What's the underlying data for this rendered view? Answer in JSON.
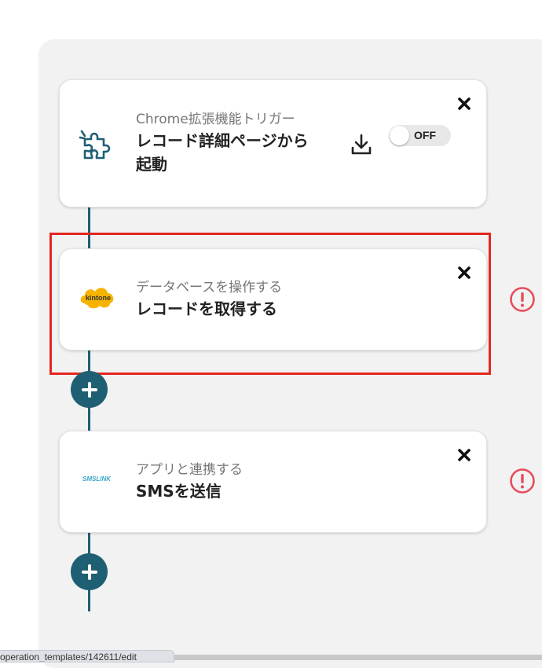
{
  "colors": {
    "accent": "#1f5f74",
    "highlight": "#e3261f",
    "warning": "#e74c5c",
    "kintone": "#f6b400"
  },
  "steps": [
    {
      "subtitle": "Chrome拡張機能トリガー",
      "title": "レコード詳細ページから起動",
      "icon": "puzzle-icon",
      "toggle_label": "OFF",
      "toggle_on": false
    },
    {
      "subtitle": "データベースを操作する",
      "title": "レコードを取得する",
      "icon": "kintone-logo",
      "logo_text": "kintone"
    },
    {
      "subtitle": "アプリと連携する",
      "title": "SMSを送信",
      "icon": "smslink-logo",
      "logo_text": "SMSLINK"
    }
  ],
  "status_url": "operation_templates/142611/edit"
}
